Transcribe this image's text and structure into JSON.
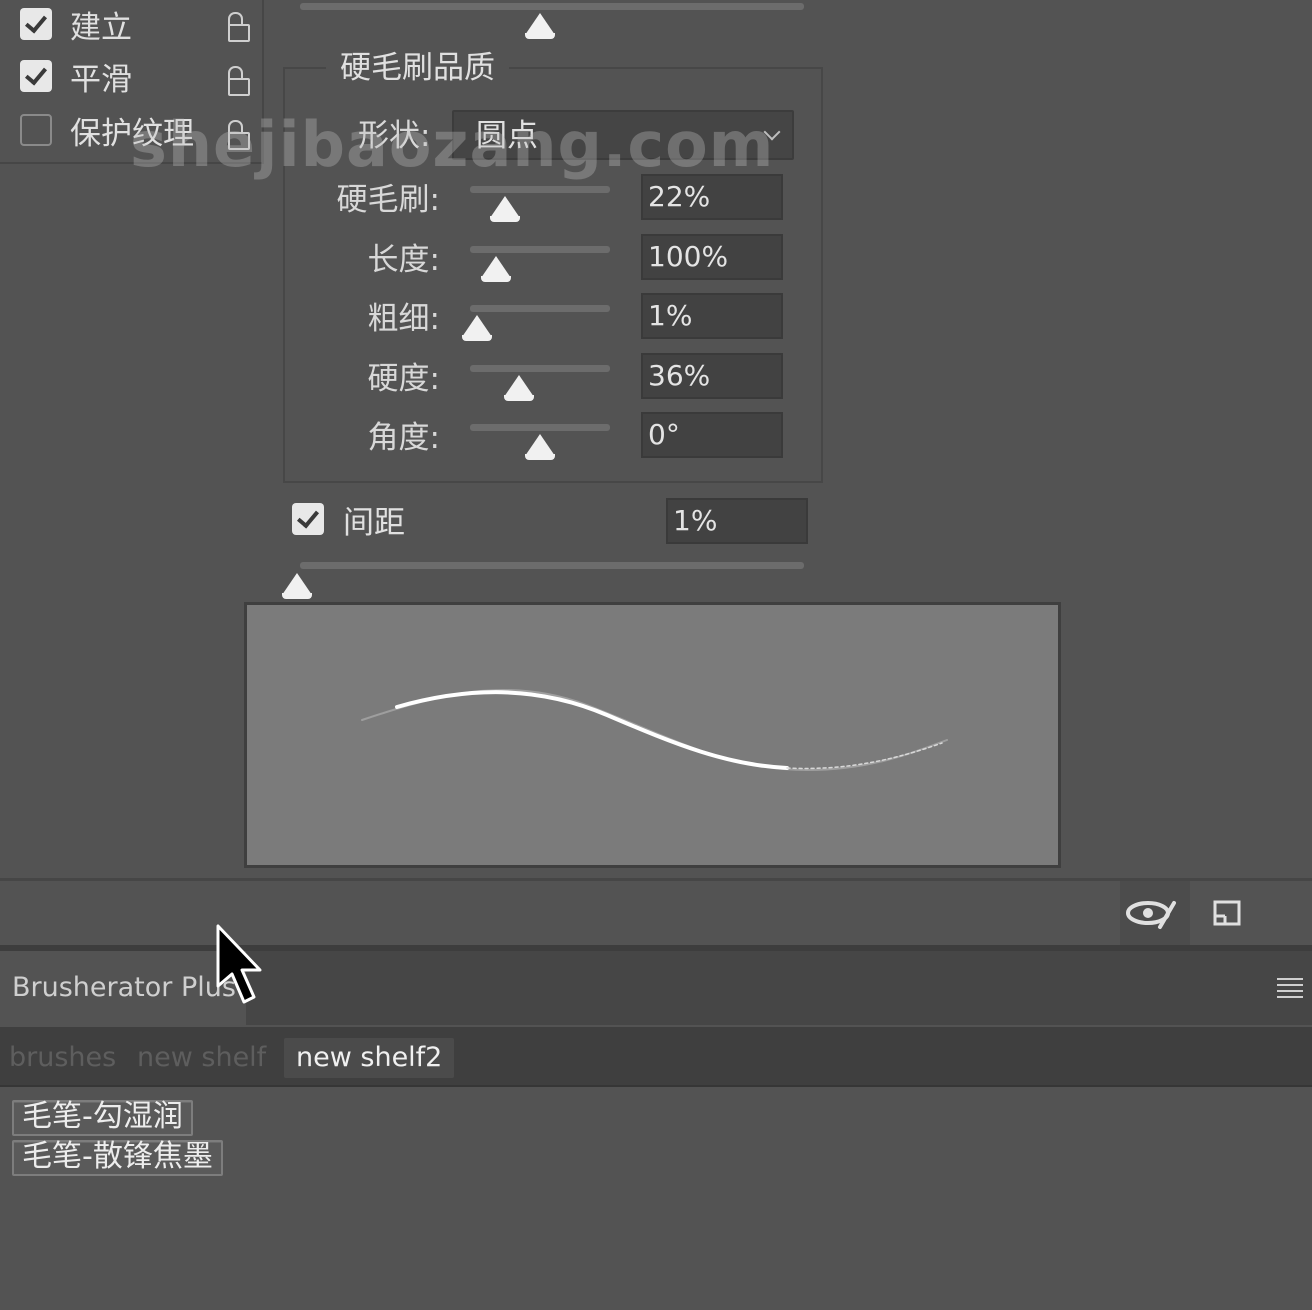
{
  "options": [
    {
      "label": "建立",
      "checked": true
    },
    {
      "label": "平滑",
      "checked": true
    },
    {
      "label": "保护纹理",
      "checked": false
    }
  ],
  "bristle": {
    "title": "硬毛刷品质",
    "shape_label": "形状:",
    "shape_value": "圆点",
    "params": [
      {
        "label": "硬毛刷:",
        "value": "22%",
        "level": 0.22
      },
      {
        "label": "长度:",
        "value": "100%",
        "level": 0.15
      },
      {
        "label": "粗细:",
        "value": "1%",
        "level": 0.0
      },
      {
        "label": "硬度:",
        "value": "36%",
        "level": 0.33
      },
      {
        "label": "角度:",
        "value": "0°",
        "level": 0.5
      }
    ]
  },
  "spacing": {
    "label": "间距",
    "checked": true,
    "value": "1%",
    "level": 0.0
  },
  "top_slider_level": 0.47,
  "icons": {
    "toggle": "eye-brush-icon",
    "new": "new-preset-icon",
    "menu": "hamburger-icon",
    "lock": "lock-icon"
  },
  "panel": {
    "title": "Brusherator Plus",
    "tabs": [
      {
        "label": "brushes",
        "active": false
      },
      {
        "label": "new shelf",
        "active": false
      },
      {
        "label": "new shelf2",
        "active": true
      }
    ],
    "brushes": [
      "毛笔-勾湿润",
      "毛笔-散锋焦墨"
    ]
  },
  "watermark": "shejibaozang.com"
}
